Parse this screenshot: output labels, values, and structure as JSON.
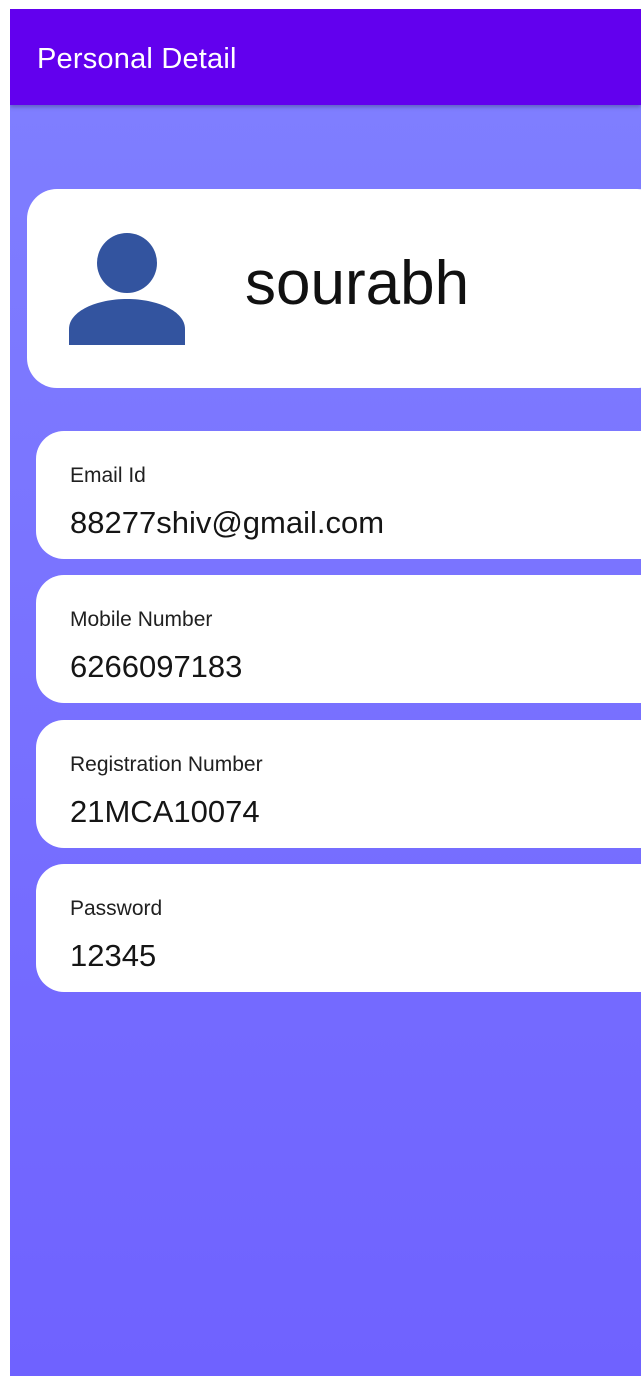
{
  "app_bar": {
    "title": "Personal Detail",
    "color": "#6200ee"
  },
  "profile": {
    "name": "sourabh",
    "avatar_icon": "person-icon",
    "avatar_color": "#33549f"
  },
  "details": [
    {
      "label": "Email Id",
      "value": "88277shiv@gmail.com"
    },
    {
      "label": "Mobile Number",
      "value": "6266097183"
    },
    {
      "label": "Registration Number",
      "value": "21MCA10074"
    },
    {
      "label": "Password",
      "value": "12345"
    }
  ],
  "colors": {
    "background_top": "#8080ff",
    "background_bottom": "#6f62ff",
    "card": "#ffffff"
  }
}
